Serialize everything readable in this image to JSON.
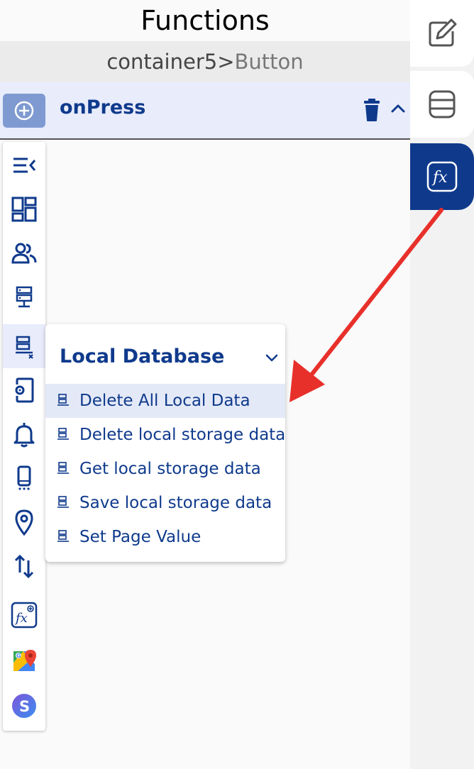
{
  "header": {
    "title": "Functions",
    "path_prefix": "container5>",
    "path_target": "Button"
  },
  "event": {
    "name": "onPress"
  },
  "categories": [
    {
      "icon": "sequence-icon"
    },
    {
      "icon": "components-icon"
    },
    {
      "icon": "users-icon"
    },
    {
      "icon": "server-icon"
    },
    {
      "icon": "local-database-icon"
    },
    {
      "icon": "device-settings-icon"
    },
    {
      "icon": "notification-bell-icon"
    },
    {
      "icon": "mobile-device-icon"
    },
    {
      "icon": "location-pin-icon"
    },
    {
      "icon": "transfer-arrows-icon"
    },
    {
      "icon": "custom-function-icon"
    },
    {
      "icon": "google-maps-icon"
    },
    {
      "icon": "s-logo-icon"
    }
  ],
  "dropdown": {
    "title": "Local Database",
    "items": [
      {
        "label": "Delete All Local Data"
      },
      {
        "label": "Delete local storage data"
      },
      {
        "label": "Get local storage data"
      },
      {
        "label": "Save local storage data"
      },
      {
        "label": "Set Page Value"
      }
    ]
  },
  "right_tabs": [
    {
      "icon": "edit-icon",
      "active": false
    },
    {
      "icon": "database-icon",
      "active": false
    },
    {
      "icon": "fx-icon",
      "active": true
    }
  ],
  "colors": {
    "accent": "#0f3a8c",
    "highlight": "#e8ecfb",
    "arrow": "#e8302a"
  }
}
